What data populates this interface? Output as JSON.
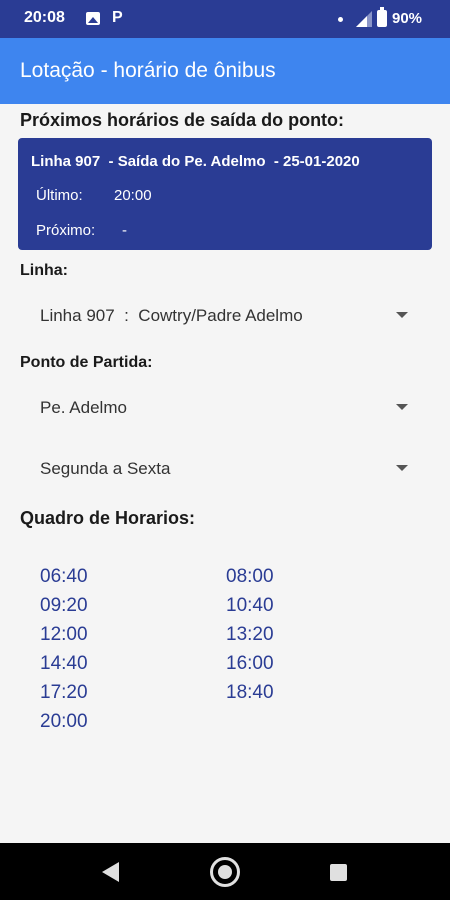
{
  "status_bar": {
    "time": "20:08",
    "p_icon_text": "P",
    "battery_percent": "90%",
    "icons": [
      "photo-icon",
      "p-app-icon",
      "dot-icon",
      "signal-icon",
      "battery-icon"
    ]
  },
  "app_bar": {
    "title": "Lotação - horário de ônibus",
    "color": "#3e85ef"
  },
  "next_departures": {
    "heading": "Próximos horários de saída do ponto:",
    "card": {
      "header": "Linha 907  - Saída do Pe. Adelmo  - 25-01-2020",
      "last_label": "Último:",
      "last_value": "20:00",
      "next_label": "Próximo:",
      "next_value": "-",
      "color": "#2a3c94"
    }
  },
  "line": {
    "label": "Linha:",
    "selected": "Linha 907  :  Cowtry/Padre Adelmo"
  },
  "departure_point": {
    "label": "Ponto de Partida:",
    "selected_point": "Pe. Adelmo",
    "selected_days": "Segunda a Sexta"
  },
  "schedule": {
    "heading": "Quadro de Horarios:",
    "times": [
      "06:40",
      "08:00",
      "09:20",
      "10:40",
      "12:00",
      "13:20",
      "14:40",
      "16:00",
      "17:20",
      "18:40",
      "20:00"
    ]
  },
  "nav_bar": {
    "icons": [
      "back-icon",
      "home-icon",
      "recents-icon"
    ]
  }
}
